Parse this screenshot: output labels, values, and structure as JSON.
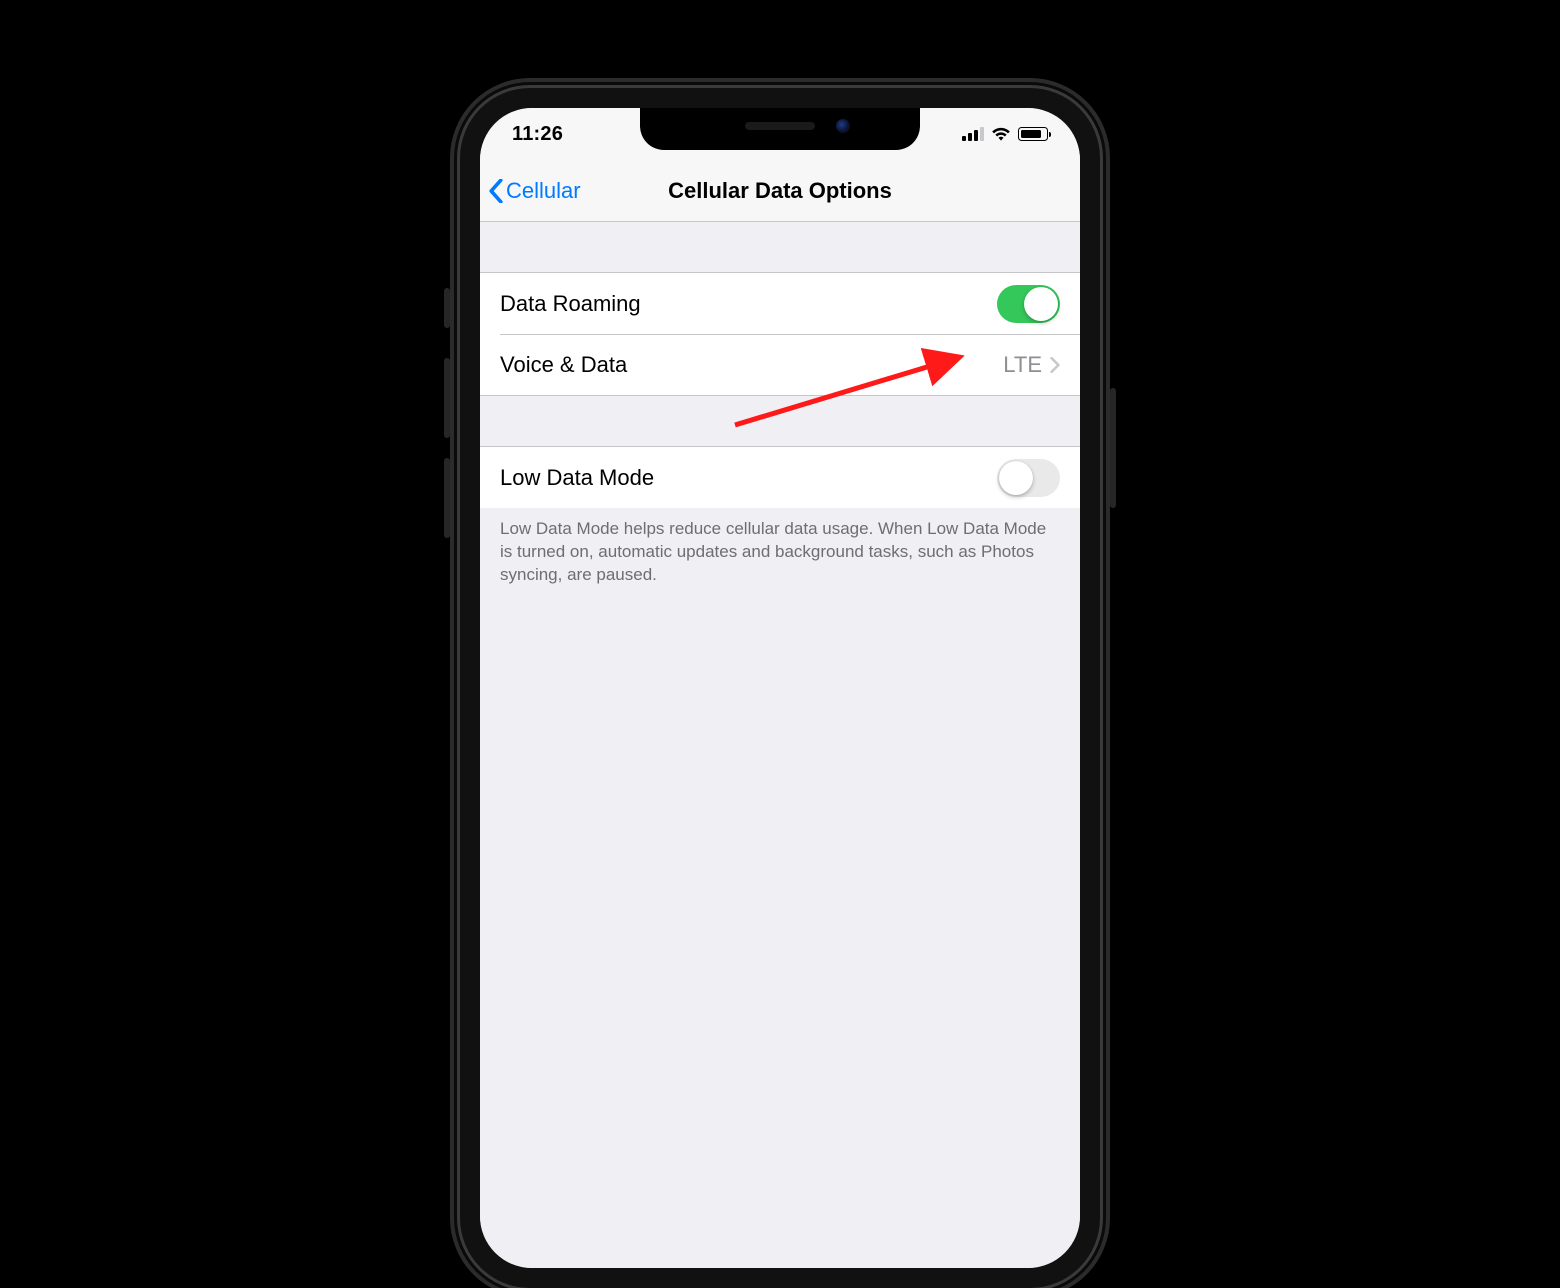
{
  "statusbar": {
    "time": "11:26"
  },
  "nav": {
    "back_label": "Cellular",
    "title": "Cellular Data Options"
  },
  "group1": {
    "data_roaming": {
      "label": "Data Roaming",
      "on": true
    },
    "voice_data": {
      "label": "Voice & Data",
      "value": "LTE"
    }
  },
  "group2": {
    "low_data_mode": {
      "label": "Low Data Mode",
      "on": false
    },
    "footer": "Low Data Mode helps reduce cellular data usage. When Low Data Mode is turned on, automatic updates and background tasks, such as Photos syncing, are paused."
  }
}
